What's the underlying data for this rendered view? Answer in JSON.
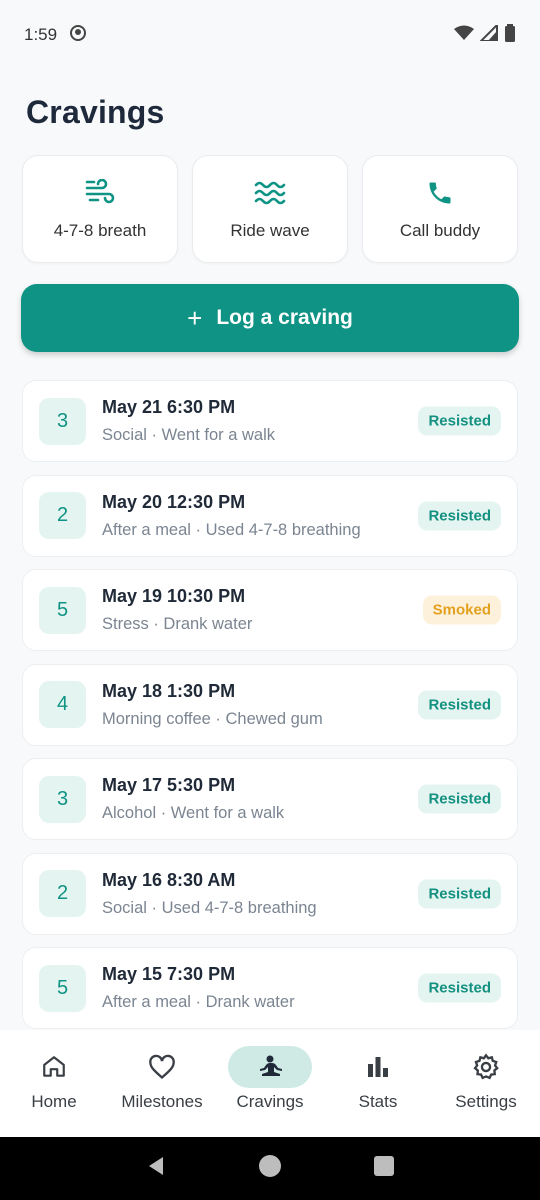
{
  "status": {
    "time": "1:59"
  },
  "title": "Cravings",
  "tools": [
    {
      "label": "4-7-8 breath",
      "icon": "wind-icon"
    },
    {
      "label": "Ride wave",
      "icon": "waves-icon"
    },
    {
      "label": "Call buddy",
      "icon": "phone-icon"
    }
  ],
  "log_button": {
    "plus": "+",
    "label": "Log a craving"
  },
  "entries": [
    {
      "intensity": "3",
      "title": "May 21 6:30 PM",
      "subtitle": "Social · Went for a walk",
      "status": "Resisted"
    },
    {
      "intensity": "2",
      "title": "May 20 12:30 PM",
      "subtitle": "After a meal · Used 4-7-8 breathing",
      "status": "Resisted"
    },
    {
      "intensity": "5",
      "title": "May 19 10:30 PM",
      "subtitle": "Stress · Drank water",
      "status": "Smoked"
    },
    {
      "intensity": "4",
      "title": "May 18 1:30 PM",
      "subtitle": "Morning coffee · Chewed gum",
      "status": "Resisted"
    },
    {
      "intensity": "3",
      "title": "May 17 5:30 PM",
      "subtitle": "Alcohol · Went for a walk",
      "status": "Resisted"
    },
    {
      "intensity": "2",
      "title": "May 16 8:30 AM",
      "subtitle": "Social · Used 4-7-8 breathing",
      "status": "Resisted"
    },
    {
      "intensity": "5",
      "title": "May 15 7:30 PM",
      "subtitle": "After a meal · Drank water",
      "status": "Resisted"
    }
  ],
  "nav": [
    {
      "label": "Home",
      "icon": "home-icon"
    },
    {
      "label": "Milestones",
      "icon": "heart-icon"
    },
    {
      "label": "Cravings",
      "icon": "meditation-icon",
      "active": true
    },
    {
      "label": "Stats",
      "icon": "bar-chart-icon"
    },
    {
      "label": "Settings",
      "icon": "gear-icon"
    }
  ],
  "colors": {
    "accent": "#0f9384",
    "resisted_bg": "#e3f4f1",
    "smoked_bg": "#fdf1dc",
    "smoked_text": "#e3a11f"
  }
}
